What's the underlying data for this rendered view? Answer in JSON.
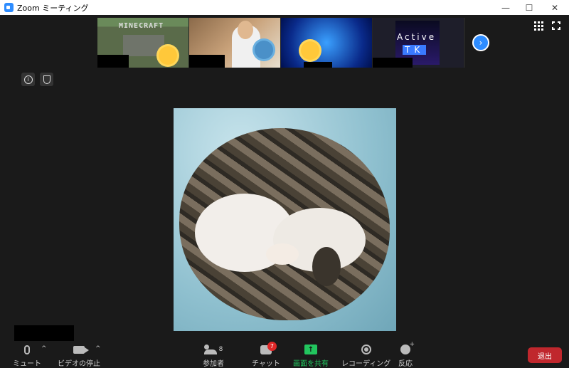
{
  "window": {
    "title": "Zoom ミーティング",
    "controls": {
      "minimize": "—",
      "maximize": "☐",
      "close": "✕"
    }
  },
  "gallery": {
    "thumbnails": [
      {
        "label": "MINECRAFT"
      },
      {
        "label": ""
      },
      {
        "label": ""
      },
      {
        "label_active": "Active",
        "label_tk": "TK"
      }
    ],
    "next_icon": "›"
  },
  "info": {
    "info_icon": "i"
  },
  "toolbar": {
    "mute_label": "ミュート",
    "video_label": "ビデオの停止",
    "participants_label": "参加者",
    "participants_count": "8",
    "chat_label": "チャット",
    "chat_badge": "7",
    "share_label": "画面を共有",
    "share_icon": "↑",
    "record_label": "レコーディング",
    "reactions_label": "反応",
    "leave_label": "退出",
    "caret": "^"
  },
  "colors": {
    "accent": "#2d8cff",
    "share": "#22c55e",
    "leave": "#c0272d",
    "badge": "#e02828"
  }
}
